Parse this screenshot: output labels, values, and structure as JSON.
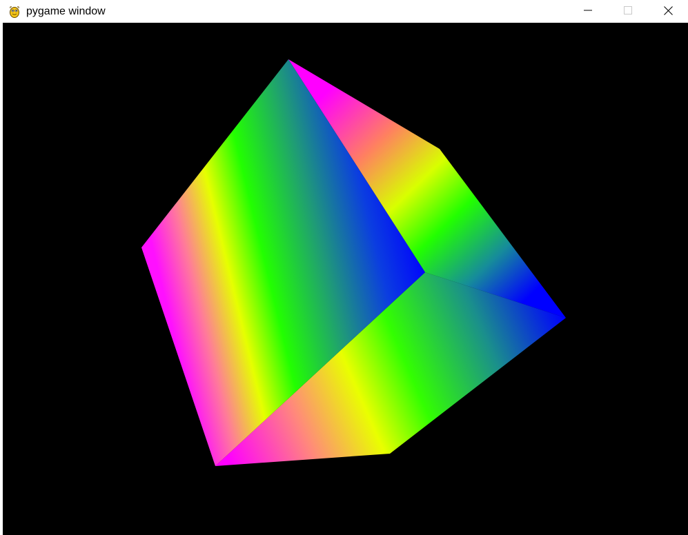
{
  "window": {
    "title": "pygame window",
    "icon": "pygame-snake-icon",
    "controls": {
      "minimize_icon": "minimize-icon",
      "maximize_icon": "maximize-icon",
      "close_icon": "close-icon"
    }
  },
  "canvas": {
    "background": "#000000",
    "scene": "rotating-rgb-cube",
    "colors": {
      "green": "#22ff00",
      "magenta": "#ff00ff",
      "yellow": "#ffff00",
      "blue": "#0000ff"
    }
  }
}
